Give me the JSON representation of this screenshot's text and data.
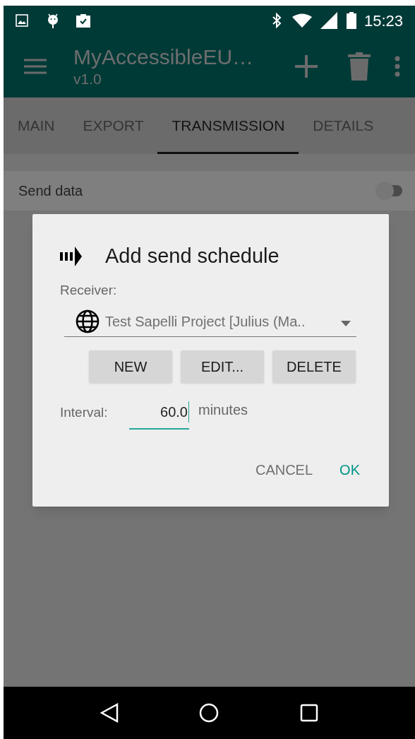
{
  "status_bar": {
    "time": "15:23"
  },
  "app_bar": {
    "title": "MyAccessibleEU…",
    "subtitle": "v1.0"
  },
  "tabs": [
    {
      "label": "MAIN",
      "selected": false
    },
    {
      "label": "EXPORT",
      "selected": false
    },
    {
      "label": "TRANSMISSION",
      "selected": true
    },
    {
      "label": "DETAILS",
      "selected": false
    }
  ],
  "settings": [
    {
      "label": "Send data",
      "on": false
    }
  ],
  "dialog": {
    "title": "Add send schedule",
    "receiver_label": "Receiver:",
    "receiver_value": "Test Sapelli Project [Julius (Ma..",
    "buttons": [
      "NEW",
      "EDIT...",
      "DELETE"
    ],
    "interval_label": "Interval:",
    "interval_value": "60.0",
    "interval_unit": "minutes",
    "actions": [
      {
        "label": "CANCEL",
        "kind": "secondary"
      },
      {
        "label": "OK",
        "kind": "primary"
      }
    ]
  }
}
